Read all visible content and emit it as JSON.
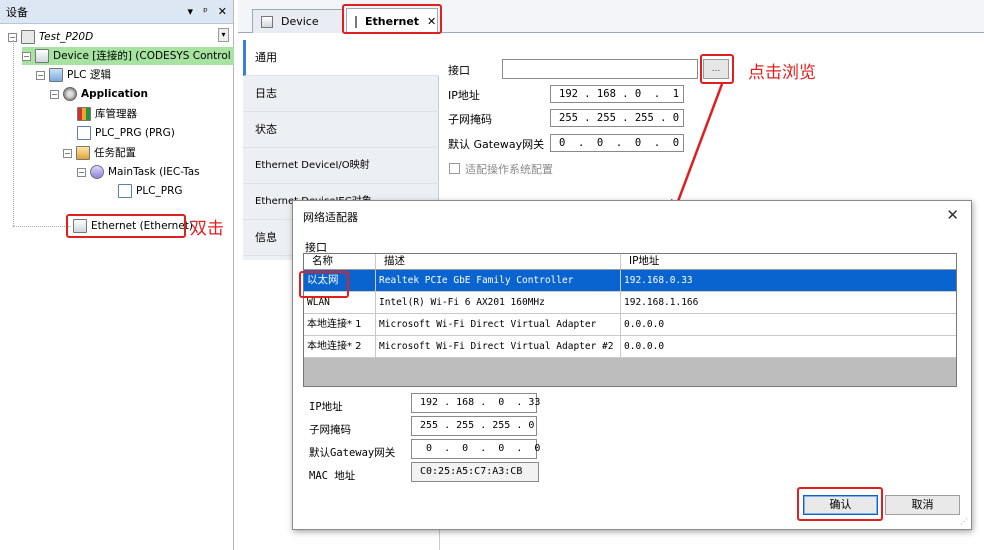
{
  "left_panel": {
    "title": "设备",
    "controls": [
      "▾",
      "ᵖ",
      "✕"
    ],
    "tree": [
      {
        "label": "Test_P20D",
        "italic": true
      },
      {
        "label": "Device [连接的] (CODESYS Control"
      },
      {
        "label": "PLC 逻辑"
      },
      {
        "label": "Application",
        "bold": true
      },
      {
        "label": "库管理器"
      },
      {
        "label": "PLC_PRG (PRG)"
      },
      {
        "label": "任务配置"
      },
      {
        "label": "MainTask (IEC-Tas"
      },
      {
        "label": "PLC_PRG"
      },
      {
        "label": "Ethernet (Ethernet)"
      }
    ],
    "annotation_double_click": "双击"
  },
  "tabs": [
    {
      "label": "Device"
    },
    {
      "label": "Ethernet"
    }
  ],
  "tab_close_glyph": "✕",
  "sidenav": [
    "通用",
    "日志",
    "状态",
    "Ethernet DeviceI/O映射",
    "Ethernet DeviceIEC对象",
    "信息"
  ],
  "general": {
    "interface_label": "接口",
    "interface_value": "",
    "browse_label": "...",
    "annotation_browse": "点击浏览",
    "ip_label": "IP地址",
    "ip_value": "192 . 168 . 0  .  1",
    "mask_label": "子网掩码",
    "mask_value": "255 . 255 . 255 . 0",
    "gateway_label": "默认 Gateway网关",
    "gateway_value": "0  .  0  .  0  .  0",
    "os_config_label": "适配操作系统配置"
  },
  "dialog": {
    "title": "网络适配器",
    "close": "✕",
    "interface_label": "接口",
    "columns": [
      "名称",
      "描述",
      "IP地址"
    ],
    "rows": [
      {
        "name": "以太网",
        "desc": "Realtek PCIe GbE Family Controller",
        "ip": "192.168.0.33",
        "selected": true
      },
      {
        "name": "WLAN",
        "desc": "Intel(R) Wi-Fi 6 AX201 160MHz",
        "ip": "192.168.1.166",
        "selected": false
      },
      {
        "name": "本地连接* 1",
        "desc": "Microsoft Wi-Fi Direct Virtual Adapter",
        "ip": "0.0.0.0",
        "selected": false
      },
      {
        "name": "本地连接* 2",
        "desc": "Microsoft Wi-Fi Direct Virtual Adapter #2",
        "ip": "0.0.0.0",
        "selected": false
      }
    ],
    "ip_label": "IP地址",
    "ip_value": "192 . 168 .  0  . 33",
    "mask_label": "子网掩码",
    "mask_value": "255 . 255 . 255 . 0",
    "gateway_label": "默认Gateway网关",
    "gateway_value": " 0  .  0  .  0  .  0",
    "mac_label": "MAC 地址",
    "mac_value": "C0:25:A5:C7:A3:CB",
    "ok_label": "确认",
    "cancel_label": "取消"
  },
  "colors": {
    "annotation": "#e0201f",
    "selection": "#0a64cf",
    "connected": "#a6e3a0"
  }
}
